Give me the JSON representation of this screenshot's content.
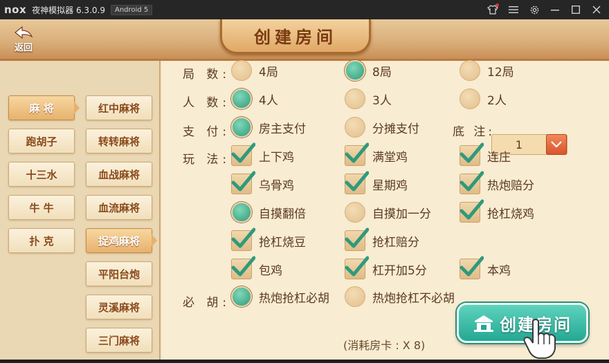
{
  "titlebar": {
    "logo": "nox",
    "title": "夜神模拟器 6.3.0.9",
    "android_badge": "Android 5",
    "icons": [
      "shirt-icon",
      "menu-icon",
      "gear-icon",
      "minimize-icon",
      "maximize-icon",
      "close-icon"
    ]
  },
  "header": {
    "back_label": "返回",
    "title": "创建房间"
  },
  "left_column_1": [
    {
      "label": "麻 将",
      "active": true
    },
    {
      "label": "跑胡子",
      "active": false
    },
    {
      "label": "十三水",
      "active": false
    },
    {
      "label": "牛 牛",
      "active": false
    },
    {
      "label": "扑 克",
      "active": false
    }
  ],
  "left_column_2": [
    {
      "label": "红中麻将",
      "active": false
    },
    {
      "label": "转转麻将",
      "active": false
    },
    {
      "label": "血战麻将",
      "active": false
    },
    {
      "label": "血流麻将",
      "active": false
    },
    {
      "label": "捉鸡麻将",
      "active": true
    },
    {
      "label": "平阳台炮",
      "active": false
    },
    {
      "label": "灵溪麻将",
      "active": false
    },
    {
      "label": "三门麻将",
      "active": false
    }
  ],
  "labels": {
    "rounds": "局 数:",
    "players": "人 数:",
    "payment": "支 付:",
    "rules": "玩 法:",
    "must_hu": "必 胡:",
    "base_score": "底 注:"
  },
  "rounds": [
    {
      "label": "4局",
      "selected": false
    },
    {
      "label": "8局",
      "selected": true
    },
    {
      "label": "12局",
      "selected": false
    }
  ],
  "players": [
    {
      "label": "4人",
      "selected": true
    },
    {
      "label": "3人",
      "selected": false
    },
    {
      "label": "2人",
      "selected": false
    }
  ],
  "payment": [
    {
      "label": "房主支付",
      "selected": true
    },
    {
      "label": "分摊支付",
      "selected": false
    }
  ],
  "base_score": {
    "value": "1"
  },
  "rules": [
    {
      "label": "上下鸡",
      "type": "check",
      "on": true
    },
    {
      "label": "满堂鸡",
      "type": "check",
      "on": true
    },
    {
      "label": "连庄",
      "type": "check",
      "on": true
    },
    {
      "label": "乌骨鸡",
      "type": "check",
      "on": true
    },
    {
      "label": "星期鸡",
      "type": "check",
      "on": true
    },
    {
      "label": "热炮赔分",
      "type": "check",
      "on": true
    },
    {
      "label": "自摸翻倍",
      "type": "radio",
      "on": true
    },
    {
      "label": "自摸加一分",
      "type": "radio",
      "on": false
    },
    {
      "label": "抢杠烧鸡",
      "type": "check",
      "on": true
    },
    {
      "label": "抢杠烧豆",
      "type": "check",
      "on": true
    },
    {
      "label": "抢杠赔分",
      "type": "check",
      "on": true
    },
    {
      "label": "包鸡",
      "type": "check",
      "on": true
    },
    {
      "label": "杠开加5分",
      "type": "check",
      "on": true
    },
    {
      "label": "本鸡",
      "type": "check",
      "on": true
    }
  ],
  "must_hu": [
    {
      "label": "热炮抢杠必胡",
      "selected": true
    },
    {
      "label": "热炮抢杠不必胡",
      "selected": false
    }
  ],
  "cost": "(消耗房卡 : X 8)",
  "create_button": "创建房间",
  "colors": {
    "accent_teal": "#2f9a7b",
    "panel_bg": "#f8ecd2",
    "text_brown": "#5a3a22"
  }
}
